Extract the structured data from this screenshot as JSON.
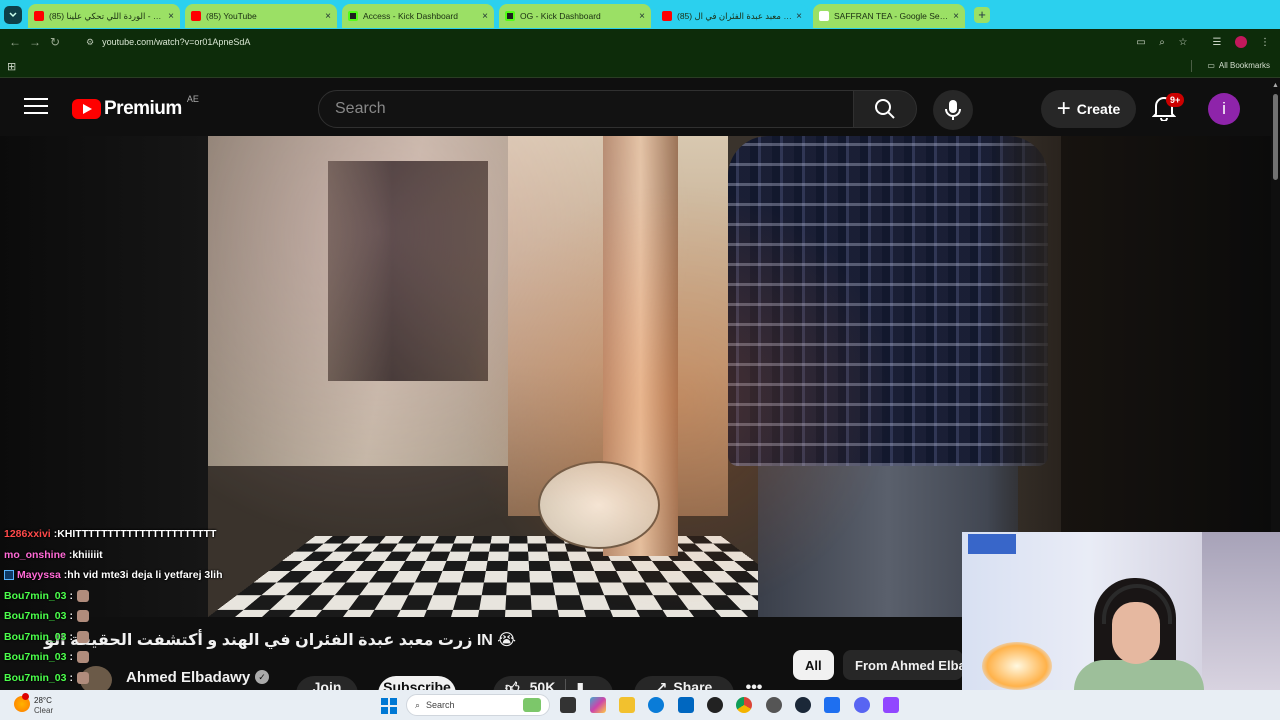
{
  "browser": {
    "tabs": [
      {
        "title": "(85) الوردة اللي تحكي علينا - ube",
        "favicon": "youtube-icon",
        "color": "#9be065",
        "active": false
      },
      {
        "title": "(85) YouTube",
        "favicon": "youtube-icon",
        "color": "#9be065",
        "active": false
      },
      {
        "title": "Access - Kick Dashboard",
        "favicon": "kick-icon",
        "color": "#9be065",
        "active": false
      },
      {
        "title": "OG - Kick Dashboard",
        "favicon": "kick-icon",
        "color": "#9be065",
        "active": false
      },
      {
        "title": "(85) زرت معبد عبدة الفئران في ال",
        "favicon": "youtube-icon",
        "color": "#2bd0ee",
        "active": true
      },
      {
        "title": "SAFFRAN TEA - Google Search",
        "favicon": "google-icon",
        "color": "#9be065",
        "active": false
      }
    ],
    "url": "youtube.com/watch?v=or01ApneSdA",
    "bookmarks_label": "All Bookmarks"
  },
  "youtube": {
    "logo_text": "Premium",
    "country_code": "AE",
    "search_placeholder": "Search",
    "create_label": "Create",
    "notification_count": "9+",
    "avatar_letter": "i",
    "video_title": "زرت معبد عبدة الفئران في الهند و أكتشفت الحقيقة الو",
    "title_suffix": "😭 IN",
    "channel_name": "Ahmed Elbadawy",
    "join_label": "Join",
    "subscribe_label": "Subscribe",
    "like_count": "50K",
    "share_label": "Share",
    "chips": [
      "All",
      "From Ahmed Elba"
    ]
  },
  "chat": [
    {
      "user": "1286xxivi",
      "color": "#ff4a4a",
      "message": "KHITTTTTTTTTTTTTTTTTTTTTT",
      "emote": false,
      "badge": false
    },
    {
      "user": "mo_onshine",
      "color": "#ff6ad5",
      "message": "khiiiiit",
      "emote": false,
      "badge": false
    },
    {
      "user": "Mayyssa",
      "color": "#ff6ad5",
      "message": "hh vid mte3i deja li yetfarej 3lih",
      "emote": false,
      "badge": true
    },
    {
      "user": "Bou7min_03",
      "color": "#4cff4c",
      "message": "",
      "emote": true,
      "badge": false
    },
    {
      "user": "Bou7min_03",
      "color": "#4cff4c",
      "message": "",
      "emote": true,
      "badge": false
    },
    {
      "user": "Bou7min_03",
      "color": "#4cff4c",
      "message": "",
      "emote": true,
      "badge": false
    },
    {
      "user": "Bou7min_03",
      "color": "#4cff4c",
      "message": "",
      "emote": true,
      "badge": false
    },
    {
      "user": "Bou7min_03",
      "color": "#4cff4c",
      "message": "",
      "emote": true,
      "badge": false
    }
  ],
  "taskbar": {
    "temperature": "28°C",
    "weather": "Clear",
    "search_placeholder": "Search"
  }
}
